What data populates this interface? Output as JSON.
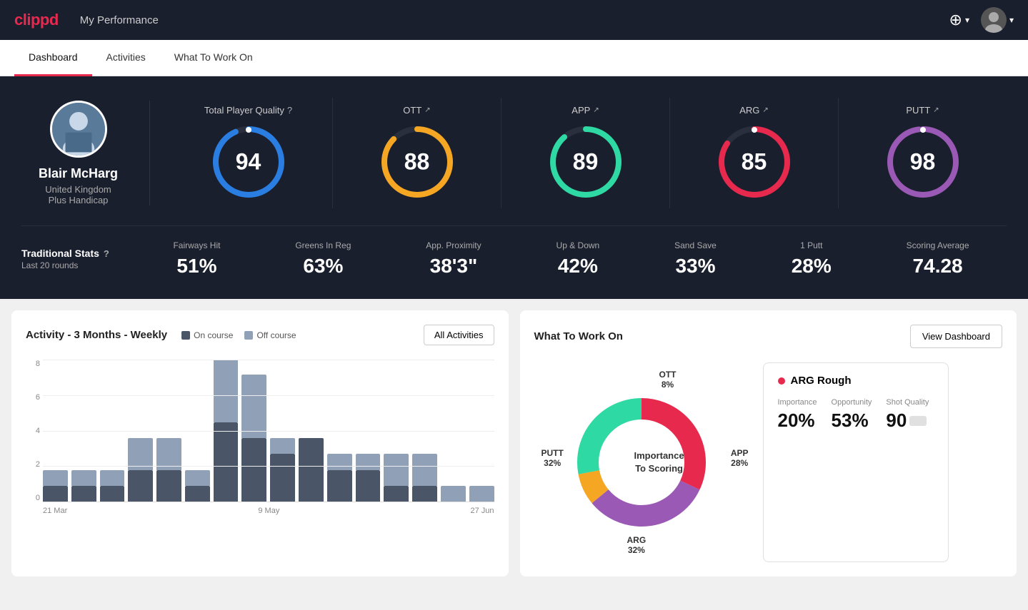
{
  "header": {
    "logo": "clippd",
    "title": "My Performance",
    "add_icon": "⊕",
    "chevron": "▾"
  },
  "nav": {
    "tabs": [
      "Dashboard",
      "Activities",
      "What To Work On"
    ],
    "active": "Dashboard"
  },
  "player": {
    "name": "Blair McHarg",
    "country": "United Kingdom",
    "handicap": "Plus Handicap"
  },
  "quality": {
    "section_title": "Total Player Quality",
    "total": {
      "value": 94,
      "color": "#2a7de1"
    },
    "ott": {
      "label": "OTT",
      "value": 88,
      "color": "#f5a623",
      "arrow": "↗"
    },
    "app": {
      "label": "APP",
      "value": 89,
      "color": "#2ed9a3",
      "arrow": "↗"
    },
    "arg": {
      "label": "ARG",
      "value": 85,
      "color": "#e8294e",
      "arrow": "↗"
    },
    "putt": {
      "label": "PUTT",
      "value": 98,
      "color": "#9b59b6",
      "arrow": "↗"
    }
  },
  "trad_stats": {
    "title": "Traditional Stats",
    "subtitle": "Last 20 rounds",
    "items": [
      {
        "label": "Fairways Hit",
        "value": "51%"
      },
      {
        "label": "Greens In Reg",
        "value": "63%"
      },
      {
        "label": "App. Proximity",
        "value": "38'3\""
      },
      {
        "label": "Up & Down",
        "value": "42%"
      },
      {
        "label": "Sand Save",
        "value": "33%"
      },
      {
        "label": "1 Putt",
        "value": "28%"
      },
      {
        "label": "Scoring Average",
        "value": "74.28"
      }
    ]
  },
  "activity_chart": {
    "title": "Activity - 3 Months - Weekly",
    "legend": {
      "oncourse": "On course",
      "offcourse": "Off course"
    },
    "all_activities_btn": "All Activities",
    "x_labels": [
      "21 Mar",
      "9 May",
      "27 Jun"
    ],
    "y_labels": [
      "8",
      "6",
      "4",
      "2",
      "0"
    ],
    "bars": [
      {
        "on": 1,
        "off": 1
      },
      {
        "on": 1,
        "off": 1
      },
      {
        "on": 1,
        "off": 1
      },
      {
        "on": 2,
        "off": 2
      },
      {
        "on": 2,
        "off": 2
      },
      {
        "on": 1,
        "off": 1
      },
      {
        "on": 5,
        "off": 4
      },
      {
        "on": 4,
        "off": 4
      },
      {
        "on": 3,
        "off": 1
      },
      {
        "on": 4,
        "off": 0
      },
      {
        "on": 2,
        "off": 1
      },
      {
        "on": 2,
        "off": 1
      },
      {
        "on": 1,
        "off": 2
      },
      {
        "on": 1,
        "off": 2
      },
      {
        "on": 0,
        "off": 1
      },
      {
        "on": 0,
        "off": 1
      }
    ]
  },
  "what_to_work_on": {
    "title": "What To Work On",
    "view_dashboard_btn": "View Dashboard",
    "donut_center": "Importance\nTo Scoring",
    "segments": [
      {
        "label": "OTT",
        "pct": "8%",
        "color": "#f5a623",
        "position": "top"
      },
      {
        "label": "APP",
        "pct": "28%",
        "color": "#2ed9a3",
        "position": "right"
      },
      {
        "label": "ARG",
        "pct": "32%",
        "color": "#e8294e",
        "position": "bottom"
      },
      {
        "label": "PUTT",
        "pct": "32%",
        "color": "#9b59b6",
        "position": "left"
      }
    ],
    "card": {
      "title": "ARG Rough",
      "dot_color": "#e8294e",
      "metrics": [
        {
          "label": "Importance",
          "value": "20%"
        },
        {
          "label": "Opportunity",
          "value": "53%"
        },
        {
          "label": "Shot Quality",
          "value": "90",
          "has_badge": true
        }
      ]
    }
  }
}
